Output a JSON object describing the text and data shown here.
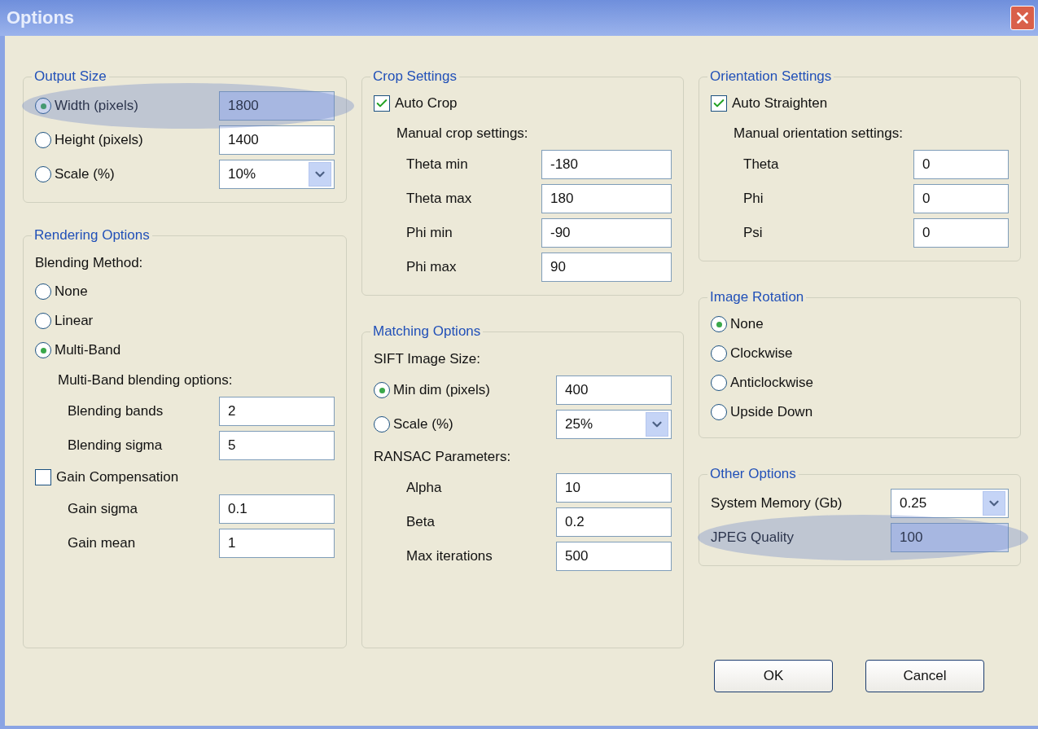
{
  "window": {
    "title": "Options"
  },
  "columns": [
    [
      {
        "title": "Output Size",
        "items": [
          {
            "kind": "radio_field",
            "label": "Width (pixels)",
            "selected": true,
            "value": "1800",
            "dropdown": false,
            "highlighted": true
          },
          {
            "kind": "radio_field",
            "label": "Height (pixels)",
            "selected": false,
            "value": "1400",
            "dropdown": false,
            "highlighted": false
          },
          {
            "kind": "radio_field",
            "label": "Scale (%)",
            "selected": false,
            "value": "10%",
            "dropdown": true,
            "highlighted": false
          }
        ]
      },
      {
        "title": "Rendering Options",
        "items": [
          {
            "kind": "heading",
            "text": "Blending Method:",
            "indent": false
          },
          {
            "kind": "radio",
            "label": "None",
            "selected": false
          },
          {
            "kind": "radio",
            "label": "Linear",
            "selected": false
          },
          {
            "kind": "radio",
            "label": "Multi-Band",
            "selected": true
          },
          {
            "kind": "heading",
            "text": "Multi-Band blending options:",
            "indent": true
          },
          {
            "kind": "field",
            "label": "Blending bands",
            "value": "2",
            "indent": true,
            "dropdown": false,
            "highlighted": false
          },
          {
            "kind": "field",
            "label": "Blending sigma",
            "value": "5",
            "indent": true,
            "dropdown": false,
            "highlighted": false
          },
          {
            "kind": "checkbox",
            "label": "Gain Compensation",
            "checked": false
          },
          {
            "kind": "field",
            "label": "Gain sigma",
            "value": "0.1",
            "indent": true,
            "dropdown": false,
            "highlighted": false
          },
          {
            "kind": "field",
            "label": "Gain mean",
            "value": "1",
            "indent": true,
            "dropdown": false,
            "highlighted": false
          }
        ]
      }
    ],
    [
      {
        "title": "Crop Settings",
        "items": [
          {
            "kind": "checkbox",
            "label": "Auto Crop",
            "checked": true
          },
          {
            "kind": "heading",
            "text": "Manual crop settings:",
            "indent": true
          },
          {
            "kind": "field",
            "label": "Theta min",
            "value": "-180",
            "indent": true,
            "dropdown": false,
            "highlighted": false
          },
          {
            "kind": "field",
            "label": "Theta max",
            "value": "180",
            "indent": true,
            "dropdown": false,
            "highlighted": false
          },
          {
            "kind": "field",
            "label": "Phi min",
            "value": "-90",
            "indent": true,
            "dropdown": false,
            "highlighted": false
          },
          {
            "kind": "field",
            "label": "Phi max",
            "value": "90",
            "indent": true,
            "dropdown": false,
            "highlighted": false
          }
        ]
      },
      {
        "title": "Matching Options",
        "items": [
          {
            "kind": "heading",
            "text": "SIFT Image Size:",
            "indent": false
          },
          {
            "kind": "radio_field",
            "label": "Min dim (pixels)",
            "selected": true,
            "value": "400",
            "dropdown": false,
            "highlighted": false
          },
          {
            "kind": "radio_field",
            "label": "Scale (%)",
            "selected": false,
            "value": "25%",
            "dropdown": true,
            "highlighted": false
          },
          {
            "kind": "heading",
            "text": "RANSAC Parameters:",
            "indent": false
          },
          {
            "kind": "field",
            "label": "Alpha",
            "value": "10",
            "indent": true,
            "dropdown": false,
            "highlighted": false
          },
          {
            "kind": "field",
            "label": "Beta",
            "value": "0.2",
            "indent": true,
            "dropdown": false,
            "highlighted": false
          },
          {
            "kind": "field",
            "label": "Max iterations",
            "value": "500",
            "indent": true,
            "dropdown": false,
            "highlighted": false
          }
        ]
      }
    ],
    [
      {
        "title": "Orientation Settings",
        "items": [
          {
            "kind": "checkbox",
            "label": "Auto Straighten",
            "checked": true
          },
          {
            "kind": "heading",
            "text": "Manual orientation settings:",
            "indent": true
          },
          {
            "kind": "field",
            "label": "Theta",
            "value": "0",
            "indent": true,
            "dropdown": false,
            "highlighted": false
          },
          {
            "kind": "field",
            "label": "Phi",
            "value": "0",
            "indent": true,
            "dropdown": false,
            "highlighted": false
          },
          {
            "kind": "field",
            "label": "Psi",
            "value": "0",
            "indent": true,
            "dropdown": false,
            "highlighted": false
          }
        ]
      },
      {
        "title": "Image Rotation",
        "items": [
          {
            "kind": "radio",
            "label": "None",
            "selected": true
          },
          {
            "kind": "radio",
            "label": "Clockwise",
            "selected": false
          },
          {
            "kind": "radio",
            "label": "Anticlockwise",
            "selected": false
          },
          {
            "kind": "radio",
            "label": "Upside Down",
            "selected": false
          }
        ]
      },
      {
        "title": "Other Options",
        "items": [
          {
            "kind": "field",
            "label": "System Memory (Gb)",
            "value": "0.25",
            "indent": false,
            "dropdown": true,
            "highlighted": false
          },
          {
            "kind": "field",
            "label": "JPEG Quality",
            "value": "100",
            "indent": false,
            "dropdown": false,
            "highlighted": true
          }
        ]
      }
    ]
  ],
  "buttons": [
    "OK",
    "Cancel"
  ]
}
